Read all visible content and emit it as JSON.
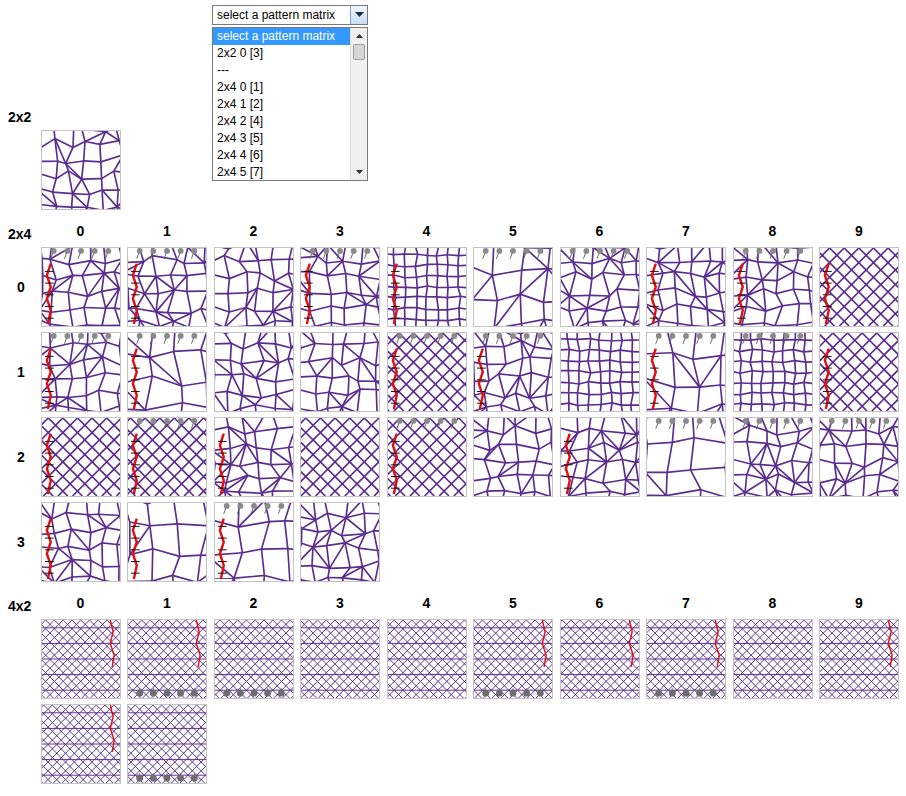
{
  "dropdown": {
    "value": "select a pattern matrix",
    "open": true,
    "options": [
      {
        "label": "select a pattern matrix",
        "selected": true
      },
      {
        "label": "2x2 0 [3]",
        "selected": false
      },
      {
        "label": "---",
        "selected": false
      },
      {
        "label": "2x4 0 [1]",
        "selected": false
      },
      {
        "label": "2x4 1 [2]",
        "selected": false
      },
      {
        "label": "2x4 2 [4]",
        "selected": false
      },
      {
        "label": "2x4 3 [5]",
        "selected": false
      },
      {
        "label": "2x4 4 [6]",
        "selected": false
      },
      {
        "label": "2x4 5 [7]",
        "selected": false
      }
    ]
  },
  "sections": [
    {
      "label": "2x2",
      "pin_side": "top",
      "edge_side": "left",
      "columns": [],
      "rows": [
        {
          "label": "",
          "thumbs": [
            {
              "kind": "mesh",
              "pins": false,
              "edge": false
            }
          ]
        }
      ]
    },
    {
      "label": "2x4",
      "pin_side": "top",
      "edge_side": "left",
      "columns": [
        "0",
        "1",
        "2",
        "3",
        "4",
        "5",
        "6",
        "7",
        "8",
        "9"
      ],
      "rows": [
        {
          "label": "0",
          "thumbs": [
            {
              "kind": "mesh",
              "pins": true,
              "edge": true
            },
            {
              "kind": "mesh",
              "pins": true,
              "edge": true
            },
            {
              "kind": "mesh",
              "pins": false,
              "edge": false
            },
            {
              "kind": "mesh",
              "pins": true,
              "edge": true
            },
            {
              "kind": "grid",
              "pins": false,
              "edge": true
            },
            {
              "kind": "rose",
              "pins": true,
              "edge": false
            },
            {
              "kind": "mesh",
              "pins": true,
              "edge": false
            },
            {
              "kind": "mesh",
              "pins": false,
              "edge": true
            },
            {
              "kind": "mesh",
              "pins": true,
              "edge": true
            },
            {
              "kind": "diamond",
              "pins": false,
              "edge": true
            }
          ]
        },
        {
          "label": "1",
          "thumbs": [
            {
              "kind": "mesh",
              "pins": true,
              "edge": true
            },
            {
              "kind": "rose",
              "pins": true,
              "edge": true
            },
            {
              "kind": "mesh",
              "pins": false,
              "edge": false
            },
            {
              "kind": "mesh",
              "pins": false,
              "edge": false
            },
            {
              "kind": "diamond",
              "pins": true,
              "edge": true
            },
            {
              "kind": "mesh",
              "pins": true,
              "edge": true
            },
            {
              "kind": "grid",
              "pins": false,
              "edge": false
            },
            {
              "kind": "rose",
              "pins": true,
              "edge": true
            },
            {
              "kind": "grid",
              "pins": true,
              "edge": false
            },
            {
              "kind": "diamond",
              "pins": false,
              "edge": true
            }
          ]
        },
        {
          "label": "2",
          "thumbs": [
            {
              "kind": "diamond",
              "pins": false,
              "edge": true
            },
            {
              "kind": "diamond",
              "pins": true,
              "edge": true
            },
            {
              "kind": "mesh",
              "pins": false,
              "edge": true
            },
            {
              "kind": "diamond",
              "pins": false,
              "edge": false
            },
            {
              "kind": "diamond",
              "pins": true,
              "edge": true
            },
            {
              "kind": "mesh",
              "pins": false,
              "edge": false
            },
            {
              "kind": "mesh",
              "pins": false,
              "edge": true
            },
            {
              "kind": "rose",
              "pins": true,
              "edge": false
            },
            {
              "kind": "mesh",
              "pins": true,
              "edge": false
            },
            {
              "kind": "mesh",
              "pins": true,
              "edge": false
            }
          ]
        },
        {
          "label": "3",
          "thumbs": [
            {
              "kind": "mesh",
              "pins": false,
              "edge": true
            },
            {
              "kind": "rose",
              "pins": false,
              "edge": true
            },
            {
              "kind": "rose",
              "pins": true,
              "edge": true
            },
            {
              "kind": "mesh",
              "pins": false,
              "edge": false
            }
          ]
        }
      ]
    },
    {
      "label": "4x2",
      "pin_side": "bottom",
      "edge_side": "right",
      "columns": [
        "0",
        "1",
        "2",
        "3",
        "4",
        "5",
        "6",
        "7",
        "8",
        "9"
      ],
      "rows": [
        {
          "label": "",
          "thumbs": [
            {
              "kind": "lattice",
              "pins": false,
              "edge": true
            },
            {
              "kind": "lattice",
              "pins": true,
              "edge": true
            },
            {
              "kind": "lattice",
              "pins": true,
              "edge": false
            },
            {
              "kind": "lattice",
              "pins": false,
              "edge": false
            },
            {
              "kind": "lattice",
              "pins": false,
              "edge": false
            },
            {
              "kind": "lattice",
              "pins": true,
              "edge": true
            },
            {
              "kind": "lattice",
              "pins": false,
              "edge": true
            },
            {
              "kind": "lattice",
              "pins": true,
              "edge": true
            },
            {
              "kind": "lattice",
              "pins": false,
              "edge": false
            },
            {
              "kind": "lattice",
              "pins": false,
              "edge": true
            }
          ]
        },
        {
          "label": "",
          "thumbs": [
            {
              "kind": "lattice",
              "pins": false,
              "edge": true
            },
            {
              "kind": "lattice",
              "pins": true,
              "edge": false
            }
          ]
        }
      ]
    }
  ]
}
